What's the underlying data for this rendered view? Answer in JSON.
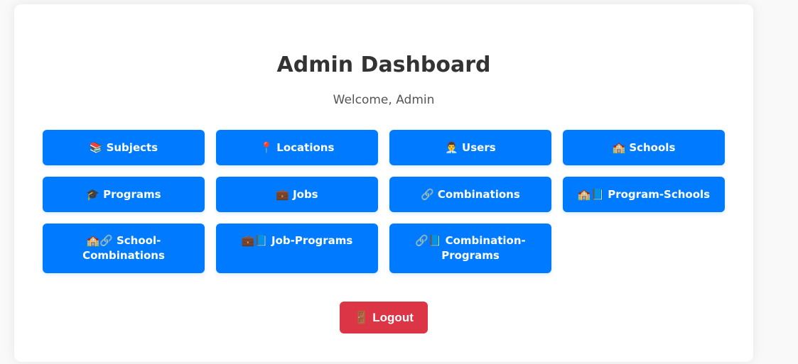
{
  "header": {
    "title": "Admin Dashboard",
    "welcome": "Welcome, Admin"
  },
  "tiles": [
    {
      "icon": "📚",
      "icon_name": "books-icon",
      "label": "Subjects"
    },
    {
      "icon": "📍",
      "icon_name": "location-pin-icon",
      "label": "Locations"
    },
    {
      "icon": "👨‍💼",
      "icon_name": "user-icon",
      "label": "Users"
    },
    {
      "icon": "🏫",
      "icon_name": "school-icon",
      "label": "Schools"
    },
    {
      "icon": "🎓",
      "icon_name": "graduation-cap-icon",
      "label": "Programs"
    },
    {
      "icon": "💼",
      "icon_name": "briefcase-icon",
      "label": "Jobs"
    },
    {
      "icon": "🔗",
      "icon_name": "link-icon",
      "label": "Combinations"
    },
    {
      "icon": "🏫📘",
      "icon_name": "school-book-icon",
      "label": "Program-Schools"
    },
    {
      "icon": "🏫🔗",
      "icon_name": "school-link-icon",
      "label": "School-\nCombinations"
    },
    {
      "icon": "💼📘",
      "icon_name": "briefcase-book-icon",
      "label": "Job-Programs"
    },
    {
      "icon": "🔗📘",
      "icon_name": "link-book-icon",
      "label": "Combination-\nPrograms"
    }
  ],
  "logout": {
    "icon": "🚪",
    "icon_name": "door-icon",
    "label": "Logout"
  },
  "colors": {
    "primary": "#007bff",
    "danger": "#dc3545",
    "text": "#333333"
  }
}
